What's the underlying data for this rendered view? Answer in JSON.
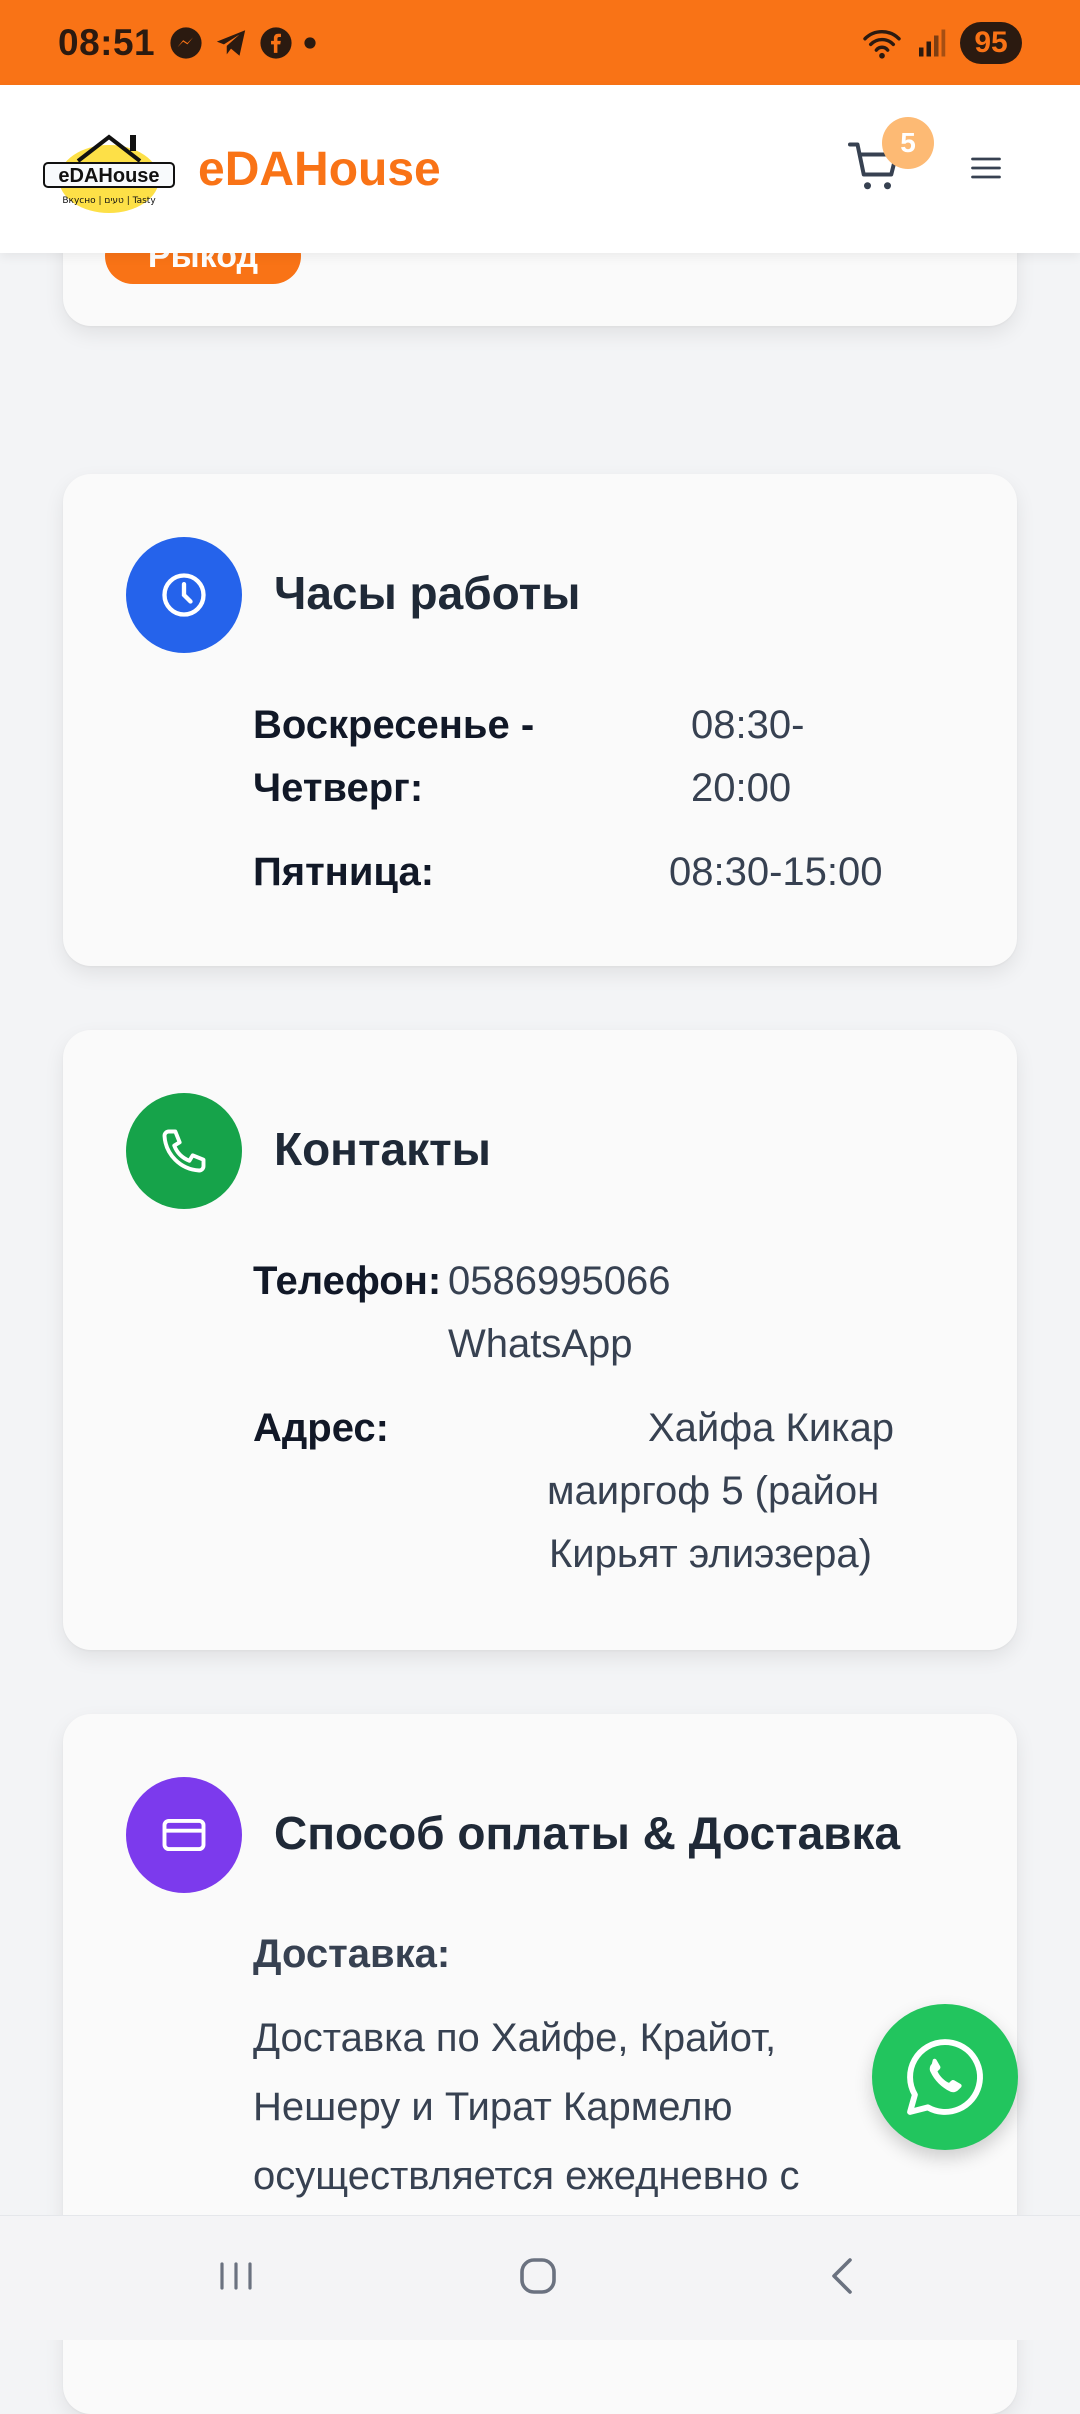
{
  "status_bar": {
    "time": "08:51",
    "battery": "95",
    "icons_left": [
      "messenger-icon",
      "telegram-icon",
      "facebook-icon",
      "dot-icon"
    ],
    "icons_right": [
      "wifi-icon",
      "signal-icon"
    ]
  },
  "header": {
    "logo_text": "eDAHouse",
    "logo_sub": "Вкусно | טעים | Tasty",
    "brand": "eDAHouse",
    "cart_count": "5"
  },
  "top_card": {
    "button_label": "Рыкод"
  },
  "hours": {
    "title": "Часы работы",
    "rows": [
      {
        "label_1": "Воскресенье -",
        "label_2": "Четверг:",
        "value_1": "08:30-",
        "value_2": "20:00"
      },
      {
        "label": "Пятница:",
        "value": "08:30-15:00"
      }
    ]
  },
  "contacts": {
    "title": "Контакты",
    "phone_label": "Телефон:",
    "phone_value": "0586995066",
    "phone_extra": "WhatsApp",
    "address_label": "Адрес:",
    "address_lines": [
      "Хайфа Кикар",
      "маиргоф 5 (район",
      "Кирьят элиэзера)"
    ]
  },
  "payment": {
    "title": "Способ оплаты & Доставка",
    "delivery_label": "Доставка:",
    "delivery_lines": [
      "Доставка по Хайфе, Крайот,",
      "Нешеру и Тират Кармелю",
      "осуществляется ежедневно с"
    ]
  },
  "colors": {
    "accent": "#f97316",
    "hours_icon": "#2563eb",
    "contacts_icon": "#16a34a",
    "payment_icon": "#7c3aed",
    "whatsapp": "#22c55e"
  }
}
